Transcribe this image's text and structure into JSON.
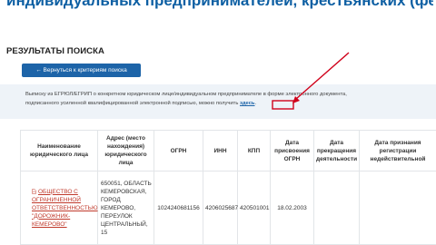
{
  "page": {
    "title": "индивидуальных предпринимателей, крестьянских (фермерских) хозяйств"
  },
  "results": {
    "heading": "РЕЗУЛЬТАТЫ ПОИСКА",
    "back_button": "← Вернуться к критериям поиска"
  },
  "notice": {
    "line1": "Выписку из ЕГРЮЛ/ЕГРИП о конкретном юридическом лице/индивидуальном предпринимателе в форме электронного документа,",
    "line2": "подписанного усиленной квалифицированной электронной подписью, можно получить",
    "link": "здесь",
    "tail": "."
  },
  "table": {
    "headers": [
      "Наименование юридического лица",
      "Адрес (место нахождения) юридического лица",
      "ОГРН",
      "ИНН",
      "КПП",
      "Дата присвоения ОГРН",
      "Дата прекращения деятельности",
      "Дата признания регистрации недействительной"
    ],
    "rows": [
      {
        "name": "ОБЩЕСТВО С ОГРАНИЧЕННОЙ ОТВЕТСТВЕННОСТЬЮ \"ДОРОЖНИК-КЕМЕРОВО\"",
        "address": "650051, ОБЛАСТЬ КЕМЕРОВСКАЯ, ГОРОД КЕМЕРОВО, ПЕРЕУЛОК ЦЕНТРАЛЬНЫЙ, 15",
        "ogrn": "1024240681156",
        "inn": "4206025687",
        "kpp": "420501001",
        "ogrn_date": "18.02.2003",
        "termination_date": "",
        "invalid_date": ""
      }
    ]
  },
  "colors": {
    "title": "#0d5fa3",
    "button": "#1d64a8",
    "annotation_arrow": "#d0021b",
    "org_link": "#c0392b"
  },
  "icons": {
    "pdf": "pdf-icon"
  }
}
